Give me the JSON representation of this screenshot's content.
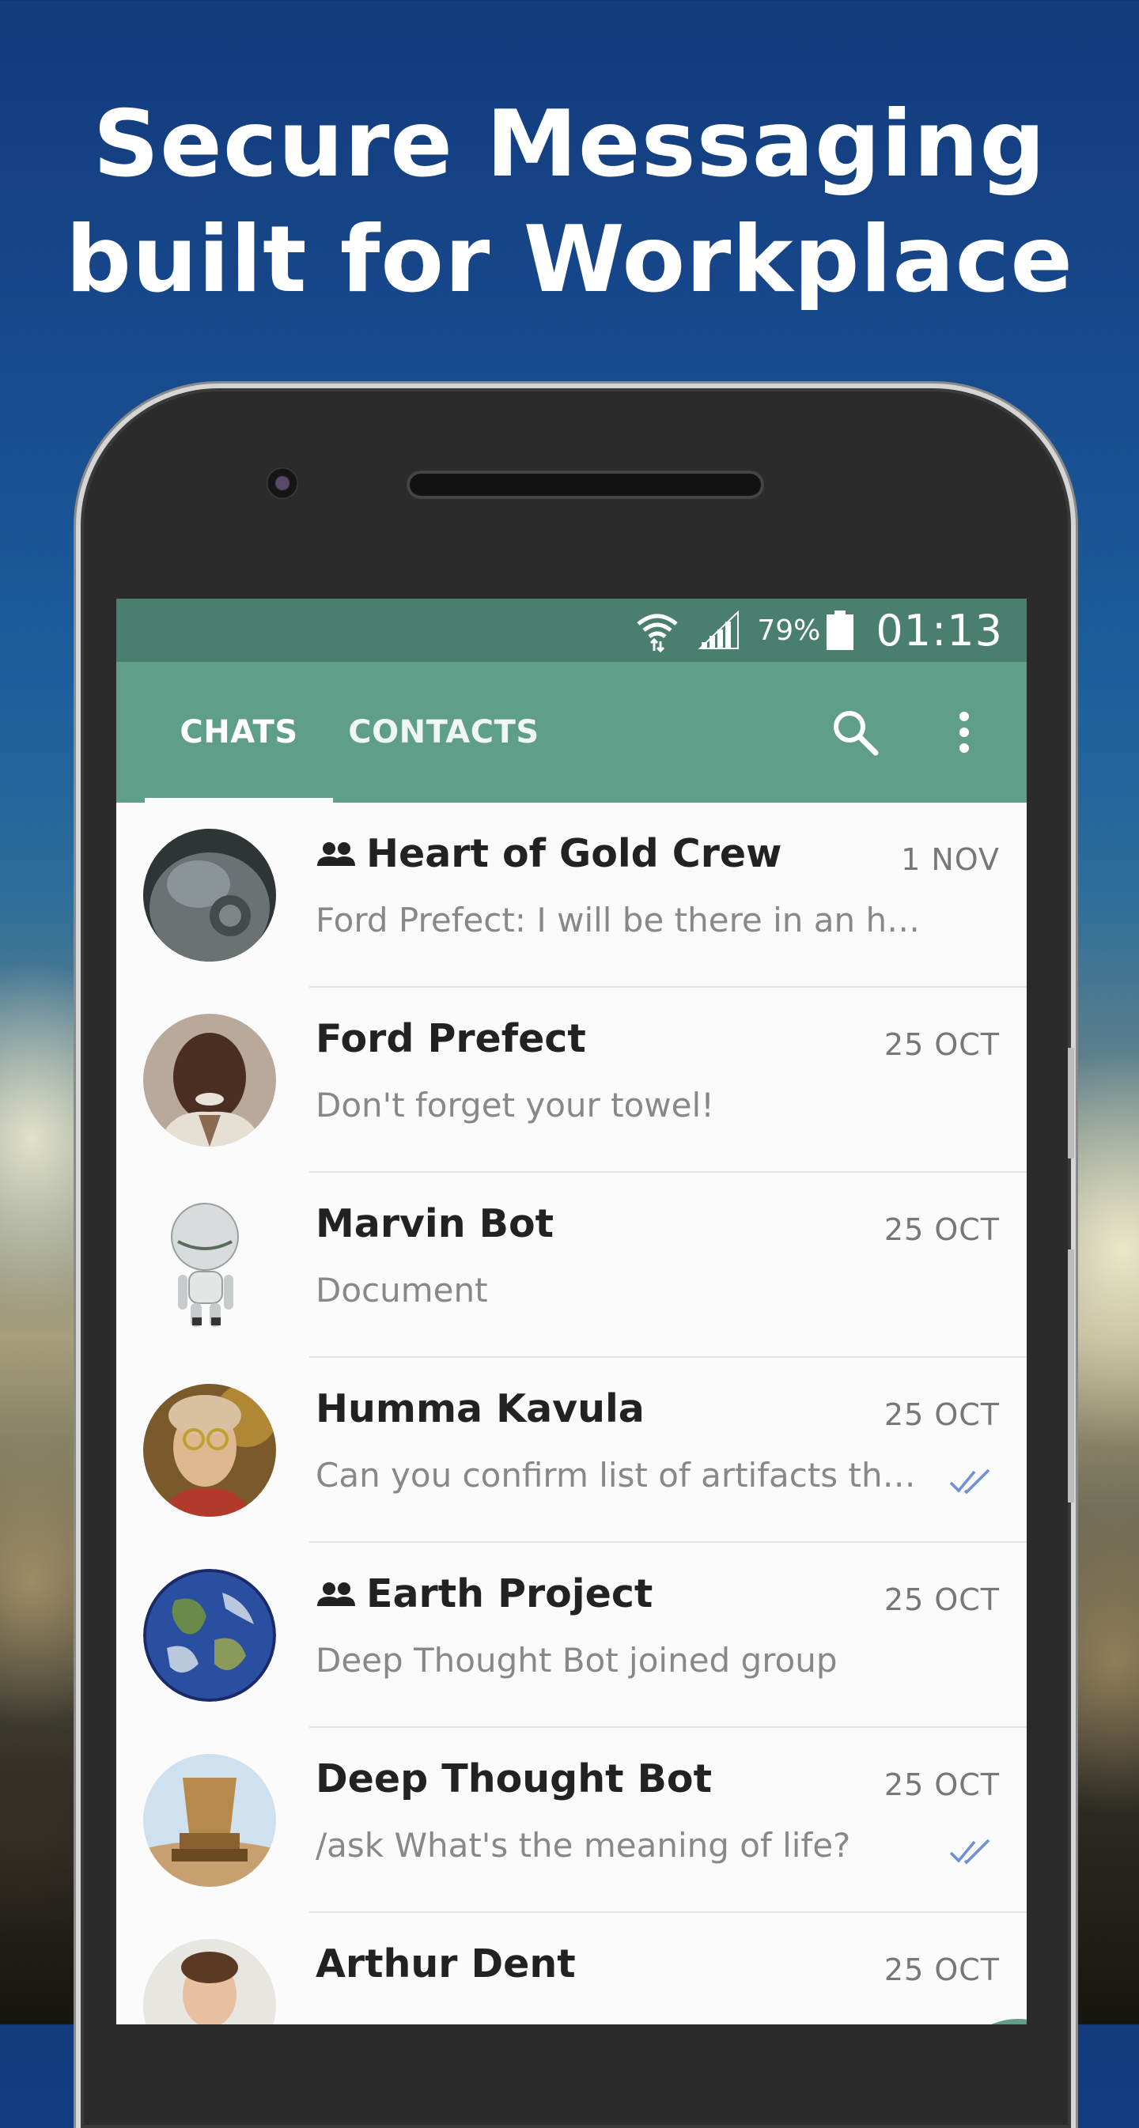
{
  "headline": {
    "line1": "Secure Messaging",
    "line2": "built for Workplace"
  },
  "status_bar": {
    "battery": "79%",
    "time": "01:13",
    "icons": [
      "wifi-icon",
      "signal-icon",
      "battery-icon"
    ]
  },
  "app_bar": {
    "tabs": [
      {
        "label": "CHATS",
        "active": true
      },
      {
        "label": "CONTACTS",
        "active": false
      }
    ],
    "actions": [
      "search-icon",
      "more-vert-icon"
    ]
  },
  "chats": [
    {
      "name": "Heart of Gold Crew",
      "group": true,
      "date": "1 NOV",
      "message": "Ford Prefect: I will be there in an h…",
      "read": false
    },
    {
      "name": "Ford Prefect",
      "group": false,
      "date": "25 OCT",
      "message": "Don't forget your towel!",
      "read": false
    },
    {
      "name": "Marvin Bot",
      "group": false,
      "date": "25 OCT",
      "message": "Document",
      "read": false
    },
    {
      "name": "Humma Kavula",
      "group": false,
      "date": "25 OCT",
      "message": "Can you confirm list of artifacts th…",
      "read": true
    },
    {
      "name": "Earth Project",
      "group": true,
      "date": "25 OCT",
      "message": "Deep Thought Bot joined group",
      "read": false
    },
    {
      "name": "Deep Thought Bot",
      "group": false,
      "date": "25 OCT",
      "message": "/ask What's the meaning of life?",
      "read": true
    },
    {
      "name": "Arthur Dent",
      "group": false,
      "date": "25 OCT",
      "message": "",
      "read": false
    }
  ],
  "colors": {
    "status_bar": "#4a7e6e",
    "app_bar": "#5f9e88",
    "read_ticks": "#6e8fd6"
  }
}
